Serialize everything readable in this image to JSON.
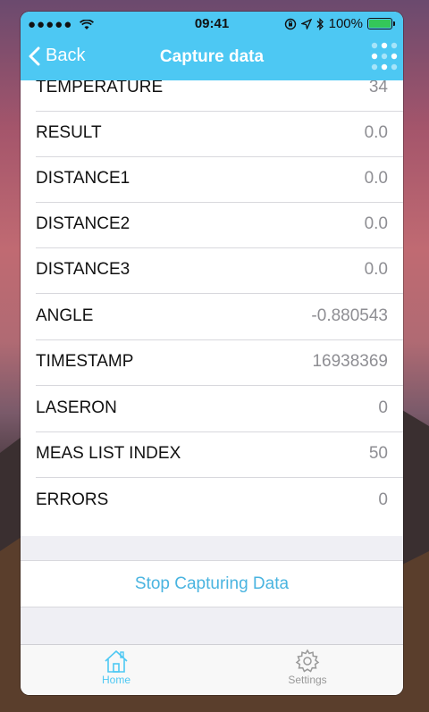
{
  "status_bar": {
    "signal": "●●●●●",
    "time": "09:41",
    "battery": "100%"
  },
  "nav": {
    "back_label": "Back",
    "title": "Capture data"
  },
  "rows": [
    {
      "label": "TEMPERATURE",
      "value": "34"
    },
    {
      "label": "RESULT",
      "value": "0.0"
    },
    {
      "label": "DISTANCE1",
      "value": "0.0"
    },
    {
      "label": "DISTANCE2",
      "value": "0.0"
    },
    {
      "label": "DISTANCE3",
      "value": "0.0"
    },
    {
      "label": "ANGLE",
      "value": "-0.880543"
    },
    {
      "label": "TIMESTAMP",
      "value": "16938369"
    },
    {
      "label": "LASERON",
      "value": "0"
    },
    {
      "label": "MEAS LIST INDEX",
      "value": "50"
    },
    {
      "label": "ERRORS",
      "value": "0"
    }
  ],
  "action": {
    "stop_label": "Stop Capturing Data"
  },
  "tabs": [
    {
      "label": "Home",
      "icon": "home-icon",
      "active": true
    },
    {
      "label": "Settings",
      "icon": "gear-icon",
      "active": false
    }
  ],
  "colors": {
    "accent": "#4dc8f3",
    "link": "#4ab4e0"
  }
}
